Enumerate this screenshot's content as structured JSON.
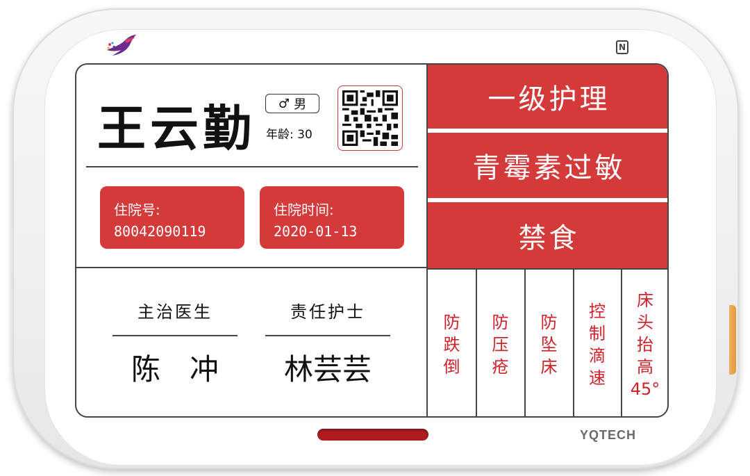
{
  "device": {
    "brand": "YQTECH",
    "nfc_symbol": "N"
  },
  "patient": {
    "name": "王云勤",
    "gender_symbol": "♂",
    "gender": "男",
    "age_label": "年龄: 30"
  },
  "admission": {
    "number_label": "住院号:",
    "number_value": "80042090119",
    "date_label": "住院时间:",
    "date_value": "2020-01-13"
  },
  "staff": {
    "doctor_role": "主治医生",
    "doctor_name": "陈　冲",
    "nurse_role": "责任护士",
    "nurse_name": "林芸芸"
  },
  "banners": {
    "care_level": "一级护理",
    "allergy": "青霉素过敏",
    "diet": "禁食"
  },
  "alerts": [
    {
      "lines": [
        "防",
        "跌",
        "倒"
      ]
    },
    {
      "lines": [
        "防",
        "压",
        "疮"
      ]
    },
    {
      "lines": [
        "防",
        "坠",
        "床"
      ]
    },
    {
      "lines": [
        "控",
        "制",
        "滴",
        "速"
      ]
    },
    {
      "lines": [
        "床",
        "头",
        "抬",
        "高",
        "45°"
      ]
    }
  ],
  "colors": {
    "accent_red": "#d53a3b",
    "alert_text_red": "#d1212a",
    "led_red": "#b01c22"
  }
}
